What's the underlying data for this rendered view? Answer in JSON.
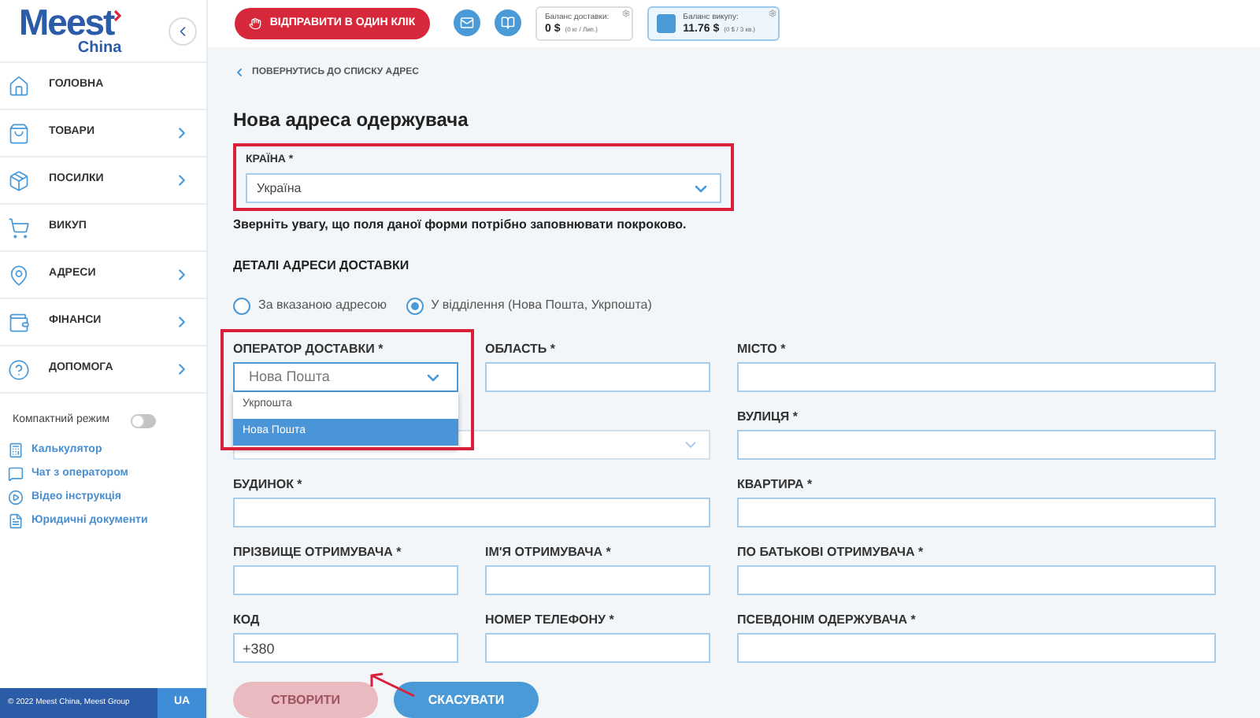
{
  "sidebar": {
    "logo": {
      "brand": "Meest",
      "sub": "China"
    },
    "nav": [
      {
        "label": "ГОЛОВНА",
        "arrow": false
      },
      {
        "label": "ТОВАРИ",
        "arrow": true
      },
      {
        "label": "ПОСИЛКИ",
        "arrow": true
      },
      {
        "label": "ВИКУП",
        "arrow": false
      },
      {
        "label": "АДРЕСИ",
        "arrow": true
      },
      {
        "label": "ФІНАНСИ",
        "arrow": true
      },
      {
        "label": "ДОПОМОГА",
        "arrow": true
      }
    ],
    "compact_mode": {
      "label": "Компактний режим",
      "on": false
    },
    "links": [
      {
        "label": "Калькулятор"
      },
      {
        "label": "Чат з оператором"
      },
      {
        "label": "Відео інструкція"
      },
      {
        "label": "Юридичні документи"
      }
    ],
    "footer": {
      "copyright": "© 2022 Meest China, Meest Group",
      "language": "UA"
    }
  },
  "header": {
    "send_button": "ВІДПРАВИТИ В ОДИН КЛІК",
    "balances": [
      {
        "label": "Баланс доставки:",
        "amount": "0 $",
        "detail": "(0 кг / Лип.)",
        "highlighted": false
      },
      {
        "label": "Баланс викупу:",
        "amount": "11.76 $",
        "detail": "(0 $ / 3 кв.)",
        "highlighted": true
      }
    ]
  },
  "main": {
    "back_link": "ПОВЕРНУТИСЬ ДО СПИСКУ АДРЕС",
    "title": "Нова адреса одержувача",
    "country": {
      "label": "КРАЇНА *",
      "value": "Україна"
    },
    "notice": "Зверніть увагу, що поля даної форми потрібно заповнювати покроково.",
    "section_title": "ДЕТАЛІ АДРЕСИ ДОСТАВКИ",
    "radios": [
      {
        "label": "За вказаною адресою",
        "selected": false
      },
      {
        "label": "У відділення (Нова Пошта, Укрпошта)",
        "selected": true
      }
    ],
    "fields": [
      {
        "kind": "dropdown",
        "label": "ОПЕРАТОР ДОСТАВКИ *",
        "placeholder": "Нова Пошта",
        "wide": false,
        "options": [
          {
            "label": "Укрпошта",
            "selected": false
          },
          {
            "label": "Нова Пошта",
            "selected": true
          }
        ]
      },
      {
        "kind": "text",
        "label": "ОБЛАСТЬ *",
        "wide": false
      },
      {
        "kind": "text",
        "label": "МІСТО *",
        "wide": false
      },
      {
        "kind": "select",
        "wide": true
      },
      {
        "kind": "text",
        "label": "ВУЛИЦЯ *",
        "wide": false
      },
      {
        "kind": "text",
        "label": "БУДИНОК *",
        "wide": true
      },
      {
        "kind": "text",
        "label": "КВАРТИРА *",
        "wide": false
      },
      {
        "kind": "text",
        "label": "ПРІЗВИЩЕ ОТРИМУВАЧА *",
        "wide": false
      },
      {
        "kind": "text",
        "label": "ІМ'Я ОТРИМУВАЧА *",
        "wide": false
      },
      {
        "kind": "text",
        "label": "ПО БАТЬКОВІ ОТРИМУВАЧА *",
        "wide": false
      },
      {
        "kind": "text",
        "label": "КОД",
        "value": "+380",
        "wide": false
      },
      {
        "kind": "text",
        "label": "НОМЕР ТЕЛЕФОНУ *",
        "wide": false
      },
      {
        "kind": "text",
        "label": "ПСЕВДОНІМ ОДЕРЖУВАЧА *",
        "wide": false
      }
    ],
    "buttons": [
      {
        "label": "СТВОРИТИ",
        "disabled": true
      },
      {
        "label": "СКАСУВАТИ",
        "disabled": false
      }
    ]
  }
}
